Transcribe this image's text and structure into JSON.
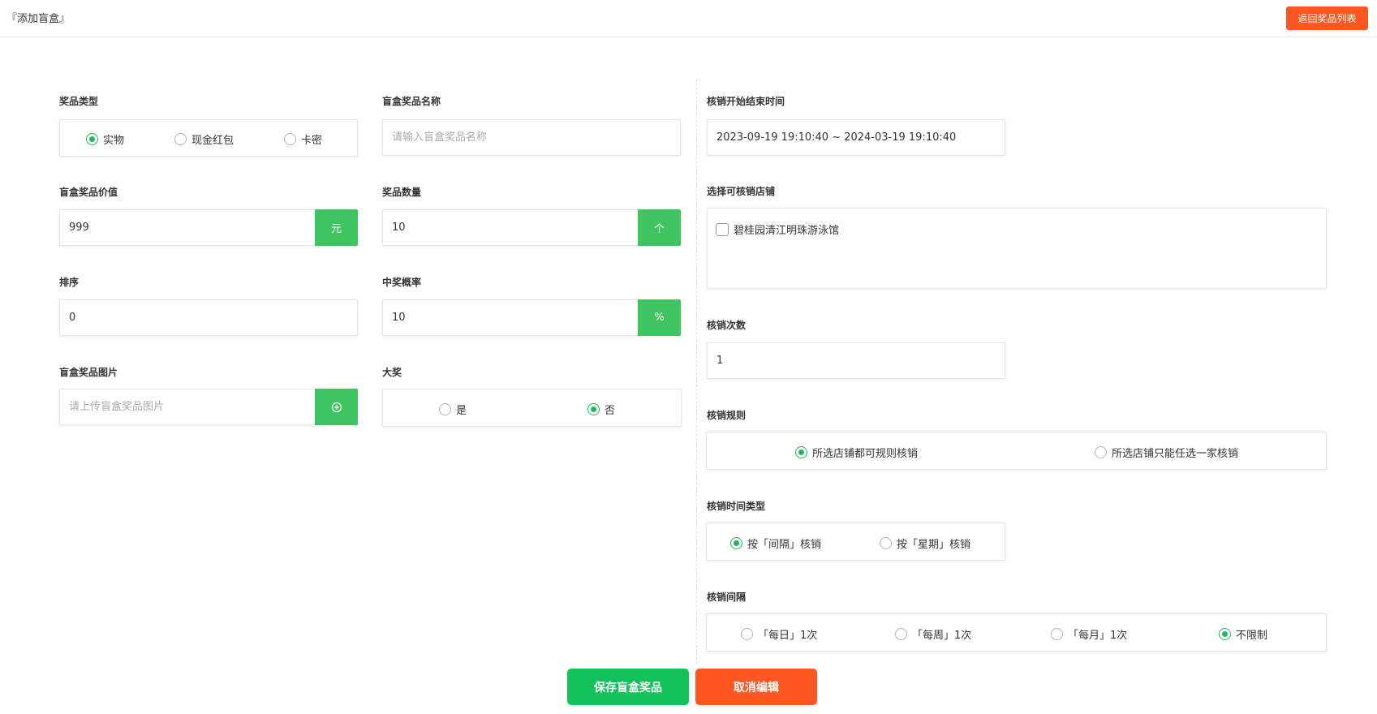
{
  "header": {
    "title": "『添加盲盒』",
    "back_button": "返回奖品列表"
  },
  "form": {
    "prize_type": {
      "label": "奖品类型",
      "options": [
        "实物",
        "现金红包",
        "卡密"
      ],
      "selected": "实物"
    },
    "prize_name": {
      "label": "盲盒奖品名称",
      "placeholder": "请输入盲盒奖品名称",
      "value": ""
    },
    "prize_value": {
      "label": "盲盒奖品价值",
      "value": "999",
      "unit": "元"
    },
    "prize_quantity": {
      "label": "奖品数量",
      "value": "10",
      "unit": "个"
    },
    "sort": {
      "label": "排序",
      "value": "0"
    },
    "win_rate": {
      "label": "中奖概率",
      "value": "10",
      "unit": "%"
    },
    "prize_image": {
      "label": "盲盒奖品图片",
      "placeholder": "请上传盲盒奖品图片",
      "upload_icon": "plus-circle-icon"
    },
    "grand_prize": {
      "label": "大奖",
      "options": [
        "是",
        "否"
      ],
      "selected": "否"
    },
    "redeem_period": {
      "label": "核销开始结束时间",
      "value": "2023-09-19 19:10:40 ~ 2024-03-19 19:10:40"
    },
    "stores": {
      "label": "选择可核销店铺",
      "items": [
        {
          "name": "碧桂园清江明珠游泳馆",
          "checked": false
        }
      ]
    },
    "redeem_count": {
      "label": "核销次数",
      "value": "1"
    },
    "redeem_rule": {
      "label": "核销规则",
      "options": [
        "所选店铺都可规则核销",
        "所选店铺只能任选一家核销"
      ],
      "selected": "所选店铺都可规则核销"
    },
    "redeem_time_type": {
      "label": "核销时间类型",
      "options": [
        "按「间隔」核销",
        "按「星期」核销"
      ],
      "selected": "按「间隔」核销"
    },
    "redeem_interval": {
      "label": "核销间隔",
      "options": [
        "「每日」1次",
        "「每周」1次",
        "「每月」1次",
        "不限制"
      ],
      "selected": "不限制"
    }
  },
  "actions": {
    "save": "保存盲盒奖品",
    "cancel": "取消编辑"
  },
  "colors": {
    "accent_green": "#3ec561",
    "radio_green": "#1fb85a",
    "orange": "#ff5722"
  }
}
